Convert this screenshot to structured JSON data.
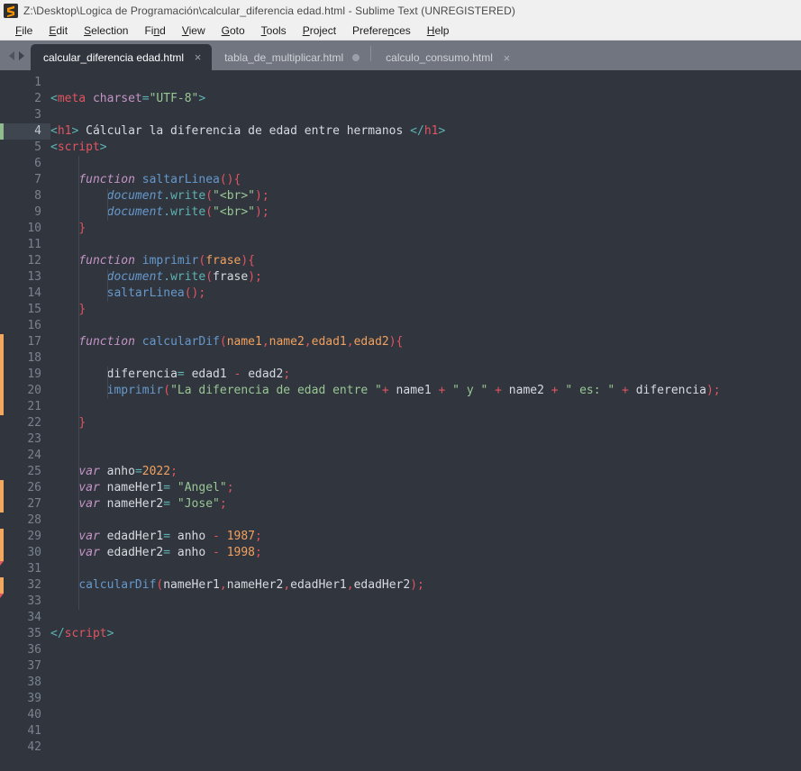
{
  "window": {
    "title": "Z:\\Desktop\\Logica de Programación\\calcular_diferencia edad.html - Sublime Text (UNREGISTERED)",
    "app_icon": "sublime-text-logo"
  },
  "menubar": {
    "items": [
      {
        "label": "File",
        "mnemonic": "F"
      },
      {
        "label": "Edit",
        "mnemonic": "E"
      },
      {
        "label": "Selection",
        "mnemonic": "S"
      },
      {
        "label": "Find",
        "mnemonic": "n"
      },
      {
        "label": "View",
        "mnemonic": "V"
      },
      {
        "label": "Goto",
        "mnemonic": "G"
      },
      {
        "label": "Tools",
        "mnemonic": "T"
      },
      {
        "label": "Project",
        "mnemonic": "P"
      },
      {
        "label": "Preferences",
        "mnemonic": "n"
      },
      {
        "label": "Help",
        "mnemonic": "H"
      }
    ]
  },
  "tabbar": {
    "prev_label": "◀",
    "next_label": "▶",
    "close_glyph": "×",
    "tabs": [
      {
        "label": "calcular_diferencia edad.html",
        "active": true,
        "modified": false
      },
      {
        "label": "tabla_de_multiplicar.html",
        "active": false,
        "modified": true
      },
      {
        "label": "calculo_consumo.html",
        "active": false,
        "modified": false
      }
    ]
  },
  "editor": {
    "current_line": 4,
    "total_lines": 42,
    "colors": {
      "background": "#30353e",
      "gutter_text": "#7b828c",
      "current_line_bg": "#3f4650",
      "marker_added": "#8fbb8f",
      "marker_modified": "#f2a85e",
      "marker_tail": "#e05561",
      "tag": "#e05561",
      "punct": "#5fb3b3",
      "attribute": "#c594c5",
      "string": "#99c794",
      "keyword": "#c594c5",
      "function": "#6699cc",
      "number": "#f2a15e",
      "parameter": "#f2a15e",
      "plain": "#d7dae0"
    },
    "change_markers": [
      {
        "start": 4,
        "end": 4,
        "kind": "added",
        "tail": false
      },
      {
        "start": 17,
        "end": 21,
        "kind": "modified",
        "tail": false
      },
      {
        "start": 26,
        "end": 27,
        "kind": "modified",
        "tail": false
      },
      {
        "start": 29,
        "end": 30,
        "kind": "modified",
        "tail": true
      },
      {
        "start": 32,
        "end": 32,
        "kind": "modified",
        "tail": true
      }
    ],
    "lines": [
      {
        "n": 1,
        "tokens": []
      },
      {
        "n": 2,
        "tokens": [
          {
            "t": "punct",
            "v": "<"
          },
          {
            "t": "tag",
            "v": "meta"
          },
          {
            "t": "plain",
            "v": " "
          },
          {
            "t": "attr",
            "v": "charset"
          },
          {
            "t": "punct",
            "v": "="
          },
          {
            "t": "string",
            "v": "\"UTF-8\""
          },
          {
            "t": "punct",
            "v": ">"
          }
        ]
      },
      {
        "n": 3,
        "tokens": []
      },
      {
        "n": 4,
        "tokens": [
          {
            "t": "punct",
            "v": "<"
          },
          {
            "t": "tag",
            "v": "h1"
          },
          {
            "t": "punct",
            "v": ">"
          },
          {
            "t": "plain",
            "v": " Cálcular la diferencia de edad entre hermanos "
          },
          {
            "t": "punct",
            "v": "</"
          },
          {
            "t": "tag",
            "v": "h1"
          },
          {
            "t": "punct",
            "v": ">"
          }
        ]
      },
      {
        "n": 5,
        "tokens": [
          {
            "t": "punct",
            "v": "<"
          },
          {
            "t": "tag",
            "v": "script"
          },
          {
            "t": "punct",
            "v": ">"
          }
        ]
      },
      {
        "n": 6,
        "tokens": []
      },
      {
        "n": 7,
        "tokens": [
          {
            "t": "plain",
            "v": "    "
          },
          {
            "t": "kw",
            "v": "function"
          },
          {
            "t": "plain",
            "v": " "
          },
          {
            "t": "fn",
            "v": "saltarLinea"
          },
          {
            "t": "bracket",
            "v": "(){"
          }
        ]
      },
      {
        "n": 8,
        "tokens": [
          {
            "t": "plain",
            "v": "        "
          },
          {
            "t": "obj",
            "v": "document"
          },
          {
            "t": "meth",
            "v": ".write"
          },
          {
            "t": "bracket",
            "v": "("
          },
          {
            "t": "string",
            "v": "\"<br>\""
          },
          {
            "t": "bracket",
            "v": ");"
          }
        ]
      },
      {
        "n": 9,
        "tokens": [
          {
            "t": "plain",
            "v": "        "
          },
          {
            "t": "obj",
            "v": "document"
          },
          {
            "t": "meth",
            "v": ".write"
          },
          {
            "t": "bracket",
            "v": "("
          },
          {
            "t": "string",
            "v": "\"<br>\""
          },
          {
            "t": "bracket",
            "v": ");"
          }
        ]
      },
      {
        "n": 10,
        "tokens": [
          {
            "t": "plain",
            "v": "    "
          },
          {
            "t": "bracket",
            "v": "}"
          }
        ]
      },
      {
        "n": 11,
        "tokens": []
      },
      {
        "n": 12,
        "tokens": [
          {
            "t": "plain",
            "v": "    "
          },
          {
            "t": "kw",
            "v": "function"
          },
          {
            "t": "plain",
            "v": " "
          },
          {
            "t": "fn",
            "v": "imprimir"
          },
          {
            "t": "bracket",
            "v": "("
          },
          {
            "t": "param",
            "v": "frase"
          },
          {
            "t": "bracket",
            "v": "){"
          }
        ]
      },
      {
        "n": 13,
        "tokens": [
          {
            "t": "plain",
            "v": "        "
          },
          {
            "t": "obj",
            "v": "document"
          },
          {
            "t": "meth",
            "v": ".write"
          },
          {
            "t": "bracket",
            "v": "("
          },
          {
            "t": "var",
            "v": "frase"
          },
          {
            "t": "bracket",
            "v": ");"
          }
        ]
      },
      {
        "n": 14,
        "tokens": [
          {
            "t": "plain",
            "v": "        "
          },
          {
            "t": "fn",
            "v": "saltarLinea"
          },
          {
            "t": "bracket",
            "v": "();"
          }
        ]
      },
      {
        "n": 15,
        "tokens": [
          {
            "t": "plain",
            "v": "    "
          },
          {
            "t": "bracket",
            "v": "}"
          }
        ]
      },
      {
        "n": 16,
        "tokens": []
      },
      {
        "n": 17,
        "tokens": [
          {
            "t": "plain",
            "v": "    "
          },
          {
            "t": "kw",
            "v": "function"
          },
          {
            "t": "plain",
            "v": " "
          },
          {
            "t": "fn",
            "v": "calcularDif"
          },
          {
            "t": "bracket",
            "v": "("
          },
          {
            "t": "param",
            "v": "name1"
          },
          {
            "t": "bracket",
            "v": ","
          },
          {
            "t": "param",
            "v": "name2"
          },
          {
            "t": "bracket",
            "v": ","
          },
          {
            "t": "param",
            "v": "edad1"
          },
          {
            "t": "bracket",
            "v": ","
          },
          {
            "t": "param",
            "v": "edad2"
          },
          {
            "t": "bracket",
            "v": "){"
          }
        ]
      },
      {
        "n": 18,
        "tokens": []
      },
      {
        "n": 19,
        "tokens": [
          {
            "t": "plain",
            "v": "        "
          },
          {
            "t": "var",
            "v": "diferencia"
          },
          {
            "t": "punct",
            "v": "="
          },
          {
            "t": "plain",
            "v": " "
          },
          {
            "t": "var",
            "v": "edad1"
          },
          {
            "t": "plain",
            "v": " "
          },
          {
            "t": "op",
            "v": "-"
          },
          {
            "t": "plain",
            "v": " "
          },
          {
            "t": "var",
            "v": "edad2"
          },
          {
            "t": "bracket",
            "v": ";"
          }
        ]
      },
      {
        "n": 20,
        "tokens": [
          {
            "t": "plain",
            "v": "        "
          },
          {
            "t": "fn",
            "v": "imprimir"
          },
          {
            "t": "bracket",
            "v": "("
          },
          {
            "t": "string",
            "v": "\"La diferencia de edad entre \""
          },
          {
            "t": "op",
            "v": "+"
          },
          {
            "t": "plain",
            "v": " "
          },
          {
            "t": "var",
            "v": "name1"
          },
          {
            "t": "plain",
            "v": " "
          },
          {
            "t": "op",
            "v": "+"
          },
          {
            "t": "plain",
            "v": " "
          },
          {
            "t": "string",
            "v": "\" y \""
          },
          {
            "t": "plain",
            "v": " "
          },
          {
            "t": "op",
            "v": "+"
          },
          {
            "t": "plain",
            "v": " "
          },
          {
            "t": "var",
            "v": "name2"
          },
          {
            "t": "plain",
            "v": " "
          },
          {
            "t": "op",
            "v": "+"
          },
          {
            "t": "plain",
            "v": " "
          },
          {
            "t": "string",
            "v": "\" es: \""
          },
          {
            "t": "plain",
            "v": " "
          },
          {
            "t": "op",
            "v": "+"
          },
          {
            "t": "plain",
            "v": " "
          },
          {
            "t": "var",
            "v": "diferencia"
          },
          {
            "t": "bracket",
            "v": ");"
          }
        ]
      },
      {
        "n": 21,
        "tokens": []
      },
      {
        "n": 22,
        "tokens": [
          {
            "t": "plain",
            "v": "    "
          },
          {
            "t": "bracket",
            "v": "}"
          }
        ]
      },
      {
        "n": 23,
        "tokens": []
      },
      {
        "n": 24,
        "tokens": []
      },
      {
        "n": 25,
        "tokens": [
          {
            "t": "plain",
            "v": "    "
          },
          {
            "t": "kw",
            "v": "var"
          },
          {
            "t": "plain",
            "v": " "
          },
          {
            "t": "var",
            "v": "anho"
          },
          {
            "t": "punct",
            "v": "="
          },
          {
            "t": "num",
            "v": "2022"
          },
          {
            "t": "bracket",
            "v": ";"
          }
        ]
      },
      {
        "n": 26,
        "tokens": [
          {
            "t": "plain",
            "v": "    "
          },
          {
            "t": "kw",
            "v": "var"
          },
          {
            "t": "plain",
            "v": " "
          },
          {
            "t": "var",
            "v": "nameHer1"
          },
          {
            "t": "punct",
            "v": "="
          },
          {
            "t": "plain",
            "v": " "
          },
          {
            "t": "string",
            "v": "\"Angel\""
          },
          {
            "t": "bracket",
            "v": ";"
          }
        ]
      },
      {
        "n": 27,
        "tokens": [
          {
            "t": "plain",
            "v": "    "
          },
          {
            "t": "kw",
            "v": "var"
          },
          {
            "t": "plain",
            "v": " "
          },
          {
            "t": "var",
            "v": "nameHer2"
          },
          {
            "t": "punct",
            "v": "="
          },
          {
            "t": "plain",
            "v": " "
          },
          {
            "t": "string",
            "v": "\"Jose\""
          },
          {
            "t": "bracket",
            "v": ";"
          }
        ]
      },
      {
        "n": 28,
        "tokens": []
      },
      {
        "n": 29,
        "tokens": [
          {
            "t": "plain",
            "v": "    "
          },
          {
            "t": "kw",
            "v": "var"
          },
          {
            "t": "plain",
            "v": " "
          },
          {
            "t": "var",
            "v": "edadHer1"
          },
          {
            "t": "punct",
            "v": "="
          },
          {
            "t": "plain",
            "v": " "
          },
          {
            "t": "var",
            "v": "anho"
          },
          {
            "t": "plain",
            "v": " "
          },
          {
            "t": "op",
            "v": "-"
          },
          {
            "t": "plain",
            "v": " "
          },
          {
            "t": "num",
            "v": "1987"
          },
          {
            "t": "bracket",
            "v": ";"
          }
        ]
      },
      {
        "n": 30,
        "tokens": [
          {
            "t": "plain",
            "v": "    "
          },
          {
            "t": "kw",
            "v": "var"
          },
          {
            "t": "plain",
            "v": " "
          },
          {
            "t": "var",
            "v": "edadHer2"
          },
          {
            "t": "punct",
            "v": "="
          },
          {
            "t": "plain",
            "v": " "
          },
          {
            "t": "var",
            "v": "anho"
          },
          {
            "t": "plain",
            "v": " "
          },
          {
            "t": "op",
            "v": "-"
          },
          {
            "t": "plain",
            "v": " "
          },
          {
            "t": "num",
            "v": "1998"
          },
          {
            "t": "bracket",
            "v": ";"
          }
        ]
      },
      {
        "n": 31,
        "tokens": []
      },
      {
        "n": 32,
        "tokens": [
          {
            "t": "plain",
            "v": "    "
          },
          {
            "t": "fn",
            "v": "calcularDif"
          },
          {
            "t": "bracket",
            "v": "("
          },
          {
            "t": "var",
            "v": "nameHer1"
          },
          {
            "t": "bracket",
            "v": ","
          },
          {
            "t": "var",
            "v": "nameHer2"
          },
          {
            "t": "bracket",
            "v": ","
          },
          {
            "t": "var",
            "v": "edadHer1"
          },
          {
            "t": "bracket",
            "v": ","
          },
          {
            "t": "var",
            "v": "edadHer2"
          },
          {
            "t": "bracket",
            "v": ");"
          }
        ]
      },
      {
        "n": 33,
        "tokens": []
      },
      {
        "n": 34,
        "tokens": []
      },
      {
        "n": 35,
        "tokens": [
          {
            "t": "punct",
            "v": "</"
          },
          {
            "t": "tag",
            "v": "script"
          },
          {
            "t": "punct",
            "v": ">"
          }
        ]
      },
      {
        "n": 36,
        "tokens": []
      },
      {
        "n": 37,
        "tokens": []
      },
      {
        "n": 38,
        "tokens": []
      },
      {
        "n": 39,
        "tokens": []
      },
      {
        "n": 40,
        "tokens": []
      },
      {
        "n": 41,
        "tokens": []
      },
      {
        "n": 42,
        "tokens": []
      }
    ]
  }
}
